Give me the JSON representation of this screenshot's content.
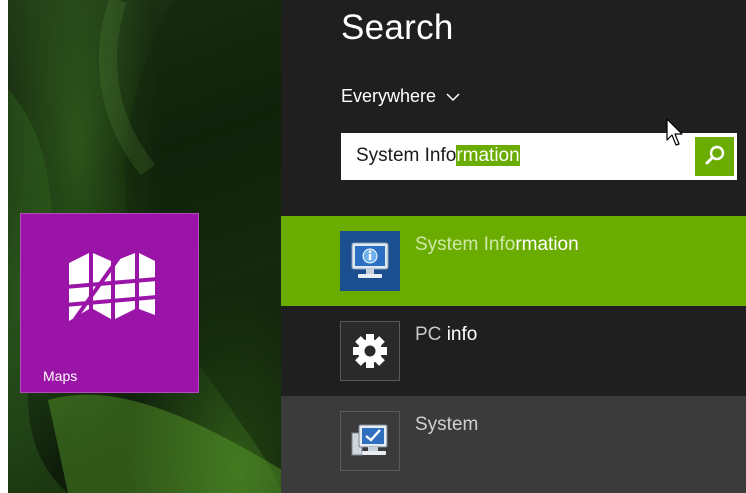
{
  "start_screen": {
    "tiles": [
      {
        "label": "Maps",
        "color": "#9b14a8",
        "icon": "maps-icon"
      }
    ]
  },
  "search": {
    "title": "Search",
    "scope": {
      "selected": "Everywhere",
      "icon": "chevron-down-icon"
    },
    "query": {
      "typed": "System Info",
      "suggested": "rmation"
    },
    "go_icon": "search-icon",
    "accent": "#6aad00"
  },
  "results": [
    {
      "pre": "System Info",
      "hl": "rmation",
      "icon": "system-information-icon",
      "selected": true
    },
    {
      "pre": "PC ",
      "hl": "info",
      "icon": "gear-icon",
      "selected": false
    },
    {
      "pre": "System",
      "hl": "",
      "icon": "system-computer-icon",
      "selected": false
    }
  ]
}
